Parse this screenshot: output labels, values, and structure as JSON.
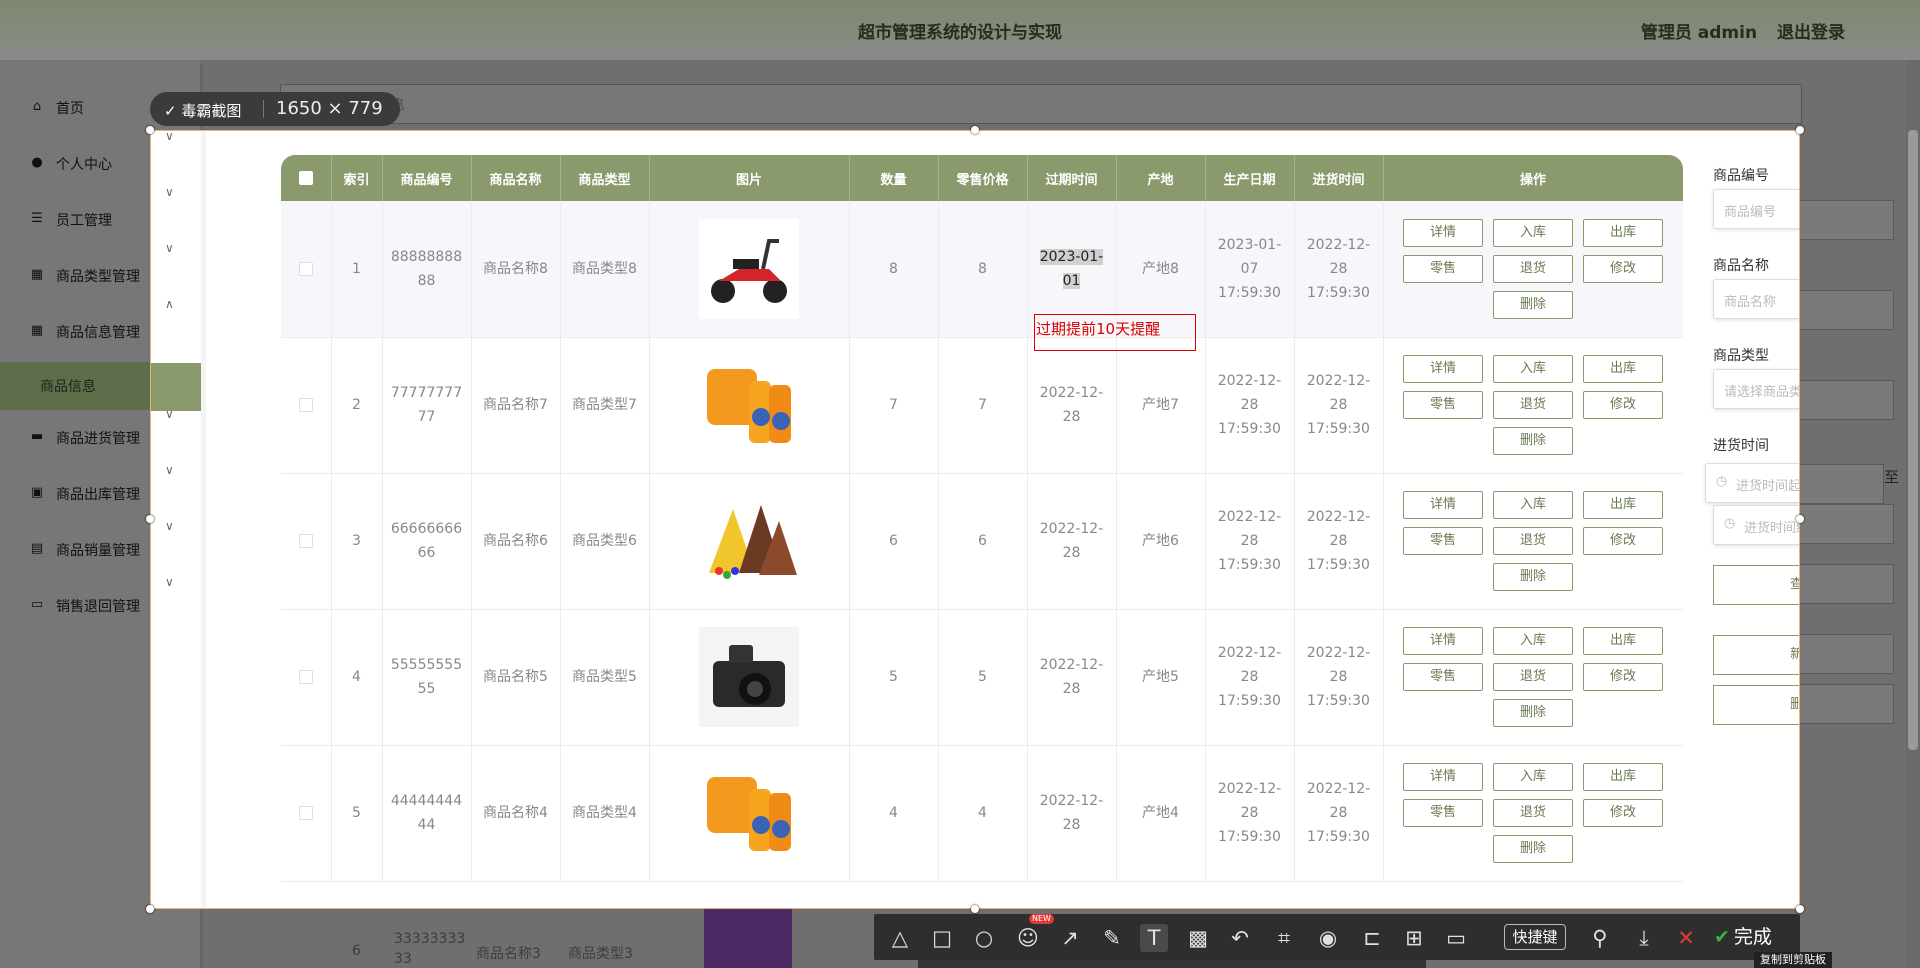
{
  "header": {
    "title": "超市管理系统的设计与实现",
    "user_role": "管理员 admin",
    "logout": "退出登录"
  },
  "sidebar": {
    "items": [
      {
        "label": "首页",
        "icon": "home-icon",
        "glyph": "⌂",
        "chevron": ""
      },
      {
        "label": "个人中心",
        "icon": "user-icon",
        "glyph": "●",
        "chevron": "∨"
      },
      {
        "label": "员工管理",
        "icon": "sliders-icon",
        "glyph": "☰",
        "chevron": "∨"
      },
      {
        "label": "商品类型管理",
        "icon": "grid-icon",
        "glyph": "▦",
        "chevron": "∨"
      },
      {
        "label": "商品信息管理",
        "icon": "grid-icon",
        "glyph": "▦",
        "chevron": "∧"
      },
      {
        "label": "商品进货管理",
        "icon": "briefcase-icon",
        "glyph": "▬",
        "chevron": "∨"
      },
      {
        "label": "商品出库管理",
        "icon": "chart-icon",
        "glyph": "▣",
        "chevron": "∨"
      },
      {
        "label": "商品销量管理",
        "icon": "clipboard-icon",
        "glyph": "▤",
        "chevron": "∨"
      },
      {
        "label": "销售退回管理",
        "icon": "monitor-icon",
        "glyph": "▭",
        "chevron": "∨"
      }
    ],
    "active_sub": "商品信息"
  },
  "search_bar_text": "息",
  "screenshot_tool": {
    "app_name": "毒霸截图",
    "dimensions": "1650 × 779",
    "shortcut_label": "快捷键",
    "done_label": "完成",
    "copy_tip": "复制到剪贴板",
    "new_tag": "NEW"
  },
  "table": {
    "columns": [
      "索引",
      "商品编号",
      "商品名称",
      "商品类型",
      "图片",
      "数量",
      "零售价格",
      "过期时间",
      "产地",
      "生产日期",
      "进货时间",
      "操作"
    ],
    "rows": [
      {
        "index": "1",
        "code": "88888888\n88",
        "name": "商品名称8",
        "type": "商品类型8",
        "image": "red-scooter-image",
        "qty": "8",
        "price": "8",
        "expire": "2023-01-01",
        "origin": "产地8",
        "produced": "2023-01-07 17:59:30",
        "stocked": "2022-12-28 17:59:30"
      },
      {
        "index": "2",
        "code": "77777777\n77",
        "name": "商品名称7",
        "type": "商品类型7",
        "image": "orange-drink-image",
        "qty": "7",
        "price": "7",
        "expire": "2022-12-28",
        "origin": "产地7",
        "produced": "2022-12-28 17:59:30",
        "stocked": "2022-12-28 17:59:30"
      },
      {
        "index": "3",
        "code": "66666666\n66",
        "name": "商品名称6",
        "type": "商品类型6",
        "image": "chocolate-image",
        "qty": "6",
        "price": "6",
        "expire": "2022-12-28",
        "origin": "产地6",
        "produced": "2022-12-28 17:59:30",
        "stocked": "2022-12-28 17:59:30"
      },
      {
        "index": "4",
        "code": "55555555\n55",
        "name": "商品名称5",
        "type": "商品类型5",
        "image": "camera-image",
        "qty": "5",
        "price": "5",
        "expire": "2022-12-28",
        "origin": "产地5",
        "produced": "2022-12-28 17:59:30",
        "stocked": "2022-12-28 17:59:30"
      },
      {
        "index": "5",
        "code": "44444444\n44",
        "name": "商品名称4",
        "type": "商品类型4",
        "image": "orange-drink-image",
        "qty": "4",
        "price": "4",
        "expire": "2022-12-28",
        "origin": "产地4",
        "produced": "2022-12-28 17:59:30",
        "stocked": "2022-12-28 17:59:30"
      }
    ],
    "row_actions": [
      "详情",
      "入库",
      "出库",
      "零售",
      "退货",
      "修改",
      "删除"
    ],
    "peek_row": {
      "index": "6",
      "code": "33333333\n33",
      "name": "商品名称3",
      "type": "商品类型3"
    },
    "expire_reminder": "过期提前10天提醒"
  },
  "filters": {
    "code_label": "商品编号",
    "code_placeholder": "商品编号",
    "name_label": "商品名称",
    "name_placeholder": "商品名称",
    "type_label": "商品类型",
    "type_placeholder": "请选择商品类型",
    "time_label": "进货时间",
    "time_start": "进货时间起始",
    "time_end": "进货时间结束",
    "range_sep": "至",
    "query_button": "查询",
    "add_button": "新增",
    "delete_button": "删除"
  },
  "colors": {
    "accent": "#8a9a6c",
    "reminder": "#dd0000",
    "overlay": "#6f6f6f"
  }
}
